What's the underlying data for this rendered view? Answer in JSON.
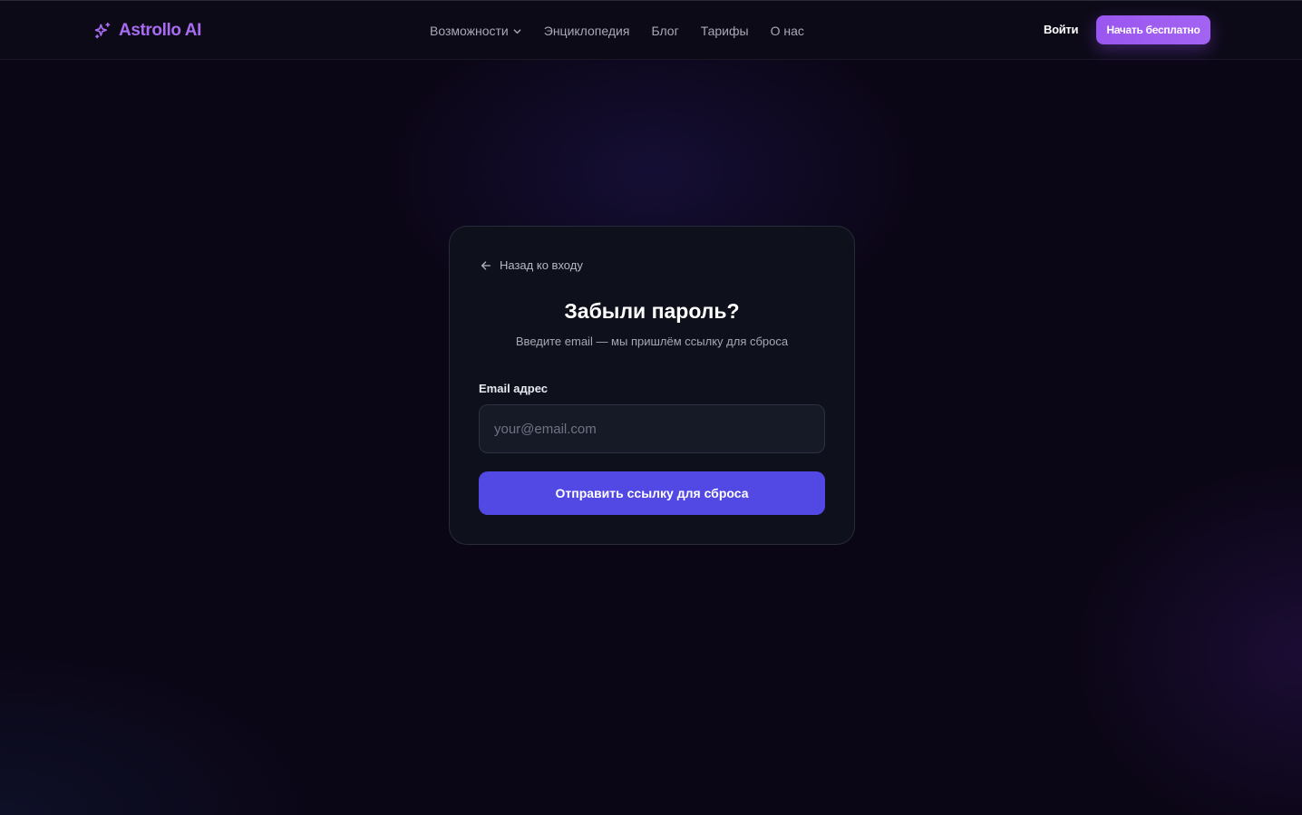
{
  "header": {
    "brand": "Astrollo AI",
    "nav": [
      {
        "label": "Возможности",
        "has_dropdown": true
      },
      {
        "label": "Энциклопедия"
      },
      {
        "label": "Блог"
      },
      {
        "label": "Тарифы"
      },
      {
        "label": "О нас"
      }
    ],
    "login_label": "Войти",
    "cta_label": "Начать бесплатно"
  },
  "card": {
    "back_label": "Назад ко входу",
    "title": "Забыли пароль?",
    "subtitle": "Введите email — мы пришлём ссылку для сброса",
    "email_label": "Email адрес",
    "email_placeholder": "your@email.com",
    "email_value": "",
    "submit_label": "Отправить ссылку для сброса"
  },
  "icons": {
    "logo": "sparkles-icon",
    "dropdown": "chevron-down-icon",
    "back": "arrow-left-icon"
  },
  "colors": {
    "brand": "#a86cf0",
    "cta": "#9a56f0",
    "primary_button": "#5248e4",
    "background": "#0b0616",
    "card": "#0e111c"
  }
}
